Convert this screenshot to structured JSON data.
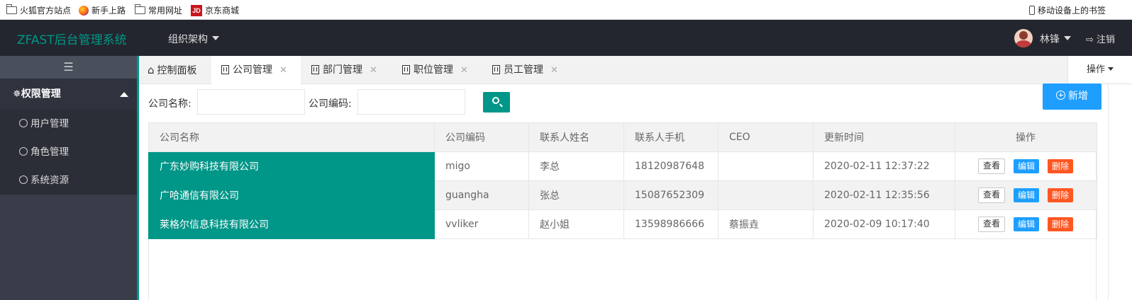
{
  "bookmarks": [
    {
      "label": "火狐官方站点",
      "icon": "folder-icon"
    },
    {
      "label": "新手上路",
      "icon": "firefox-icon"
    },
    {
      "label": "常用网址",
      "icon": "folder-icon"
    },
    {
      "label": "京东商城",
      "icon": "jd-icon"
    }
  ],
  "jd_logo": "JD",
  "mobile_bookmarks": "移动设备上的书签",
  "header": {
    "logo": "ZFAST后台管理系统",
    "org_menu": "组织架构",
    "user_name": "林锋",
    "logout": "注销"
  },
  "sidebar": {
    "toggle": "☰",
    "group": "✵权限管理",
    "items": [
      {
        "label": "用户管理"
      },
      {
        "label": "角色管理"
      },
      {
        "label": "系统资源"
      }
    ]
  },
  "tabs": [
    {
      "label": "控制面板"
    },
    {
      "label": "公司管理"
    },
    {
      "label": "部门管理"
    },
    {
      "label": "职位管理"
    },
    {
      "label": "员工管理"
    }
  ],
  "tab_ops": "操作",
  "search": {
    "name_label": "公司名称:",
    "name_value": "",
    "code_label": "公司编码:",
    "code_value": ""
  },
  "add_button": "新增",
  "table": {
    "headers": [
      "公司名称",
      "公司编码",
      "联系人姓名",
      "联系人手机",
      "CEO",
      "更新时间",
      "操作"
    ],
    "rows": [
      {
        "name": "广东妙购科技有限公司",
        "code": "migo",
        "contact": "李总",
        "phone": "18120987648",
        "ceo": "",
        "updated": "2020-02-11 12:37:22"
      },
      {
        "name": "广哈通信有限公司",
        "code": "guangha",
        "contact": "张总",
        "phone": "15087652309",
        "ceo": "",
        "updated": "2020-02-11 12:35:56"
      },
      {
        "name": "莱格尔信息科技有限公司",
        "code": "vvliker",
        "contact": "赵小姐",
        "phone": "13598986666",
        "ceo": "蔡振垚",
        "updated": "2020-02-09 10:17:40"
      }
    ],
    "actions": {
      "view": "查看",
      "edit": "编辑",
      "delete": "删除"
    }
  },
  "colors": {
    "accent": "#009688",
    "primary": "#1e9fff",
    "danger": "#ff5722",
    "header_bg": "#23262e",
    "sidebar_bg": "#393d49"
  }
}
